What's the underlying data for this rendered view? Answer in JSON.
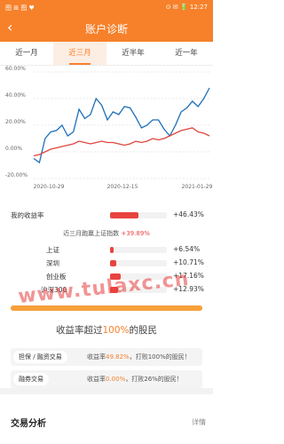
{
  "status": {
    "left": "图 ⊞ 图 ♥",
    "right": "⊙ ✉ 🔋 12:27"
  },
  "header": {
    "title": "账户诊断",
    "back": "‹"
  },
  "tabs": [
    "近一月",
    "近三月",
    "近半年",
    "近一年"
  ],
  "active_tab": 1,
  "chart_data": {
    "type": "line",
    "x_ticks": [
      "2020-10-29",
      "2020-12-15",
      "2021-01-29"
    ],
    "y_ticks": [
      "60.00%",
      "40.00%",
      "20.00%",
      "0.00%",
      "-20.00%"
    ],
    "ylim": [
      -20,
      60
    ],
    "series": [
      {
        "color": "#1d6fb8",
        "values": [
          -5,
          -8,
          10,
          15,
          16,
          20,
          12,
          15,
          32,
          25,
          28,
          40,
          35,
          24,
          30,
          28,
          34,
          33,
          26,
          18,
          20,
          24,
          24,
          17,
          12,
          20,
          30,
          33,
          38,
          34,
          40,
          48
        ]
      },
      {
        "color": "#e0453c",
        "values": [
          -3,
          -2,
          0,
          2,
          3,
          4,
          5,
          6,
          8,
          7,
          6,
          7,
          8,
          7,
          7,
          6,
          5,
          6,
          8,
          7,
          8,
          10,
          9,
          10,
          12,
          14,
          16,
          17,
          18,
          15,
          14,
          12
        ]
      }
    ]
  },
  "my_return": {
    "label": "我的收益率",
    "value": "+46.43%",
    "ratio": 0.5
  },
  "benchmark": {
    "prefix": "近三月跑赢上证指数",
    "value": "+39.89%"
  },
  "indices": [
    {
      "label": "上证",
      "value": "+6.54%",
      "ratio": 0.07
    },
    {
      "label": "深圳",
      "value": "+10.71%",
      "ratio": 0.11
    },
    {
      "label": "创业板",
      "value": "+17.16%",
      "ratio": 0.18
    },
    {
      "label": "沪深300",
      "value": "+12.93%",
      "ratio": 0.14
    }
  ],
  "watermark": "www.tulaxc.cn",
  "progress": 1.0,
  "beat": {
    "prefix": "收益率超过",
    "pct": "100%",
    "suffix": "的股民"
  },
  "cards": [
    {
      "label": "担保 / 融资交易",
      "desc_prefix": "收益率",
      "desc_value": "49.82%",
      "desc_suffix": "，打败100%的股民！"
    },
    {
      "label": "融券交易",
      "desc_prefix": "收益率",
      "desc_value": "0.00%",
      "desc_suffix": "，打败26%的股民！"
    }
  ],
  "section": {
    "title": "交易分析",
    "link": "详情"
  }
}
